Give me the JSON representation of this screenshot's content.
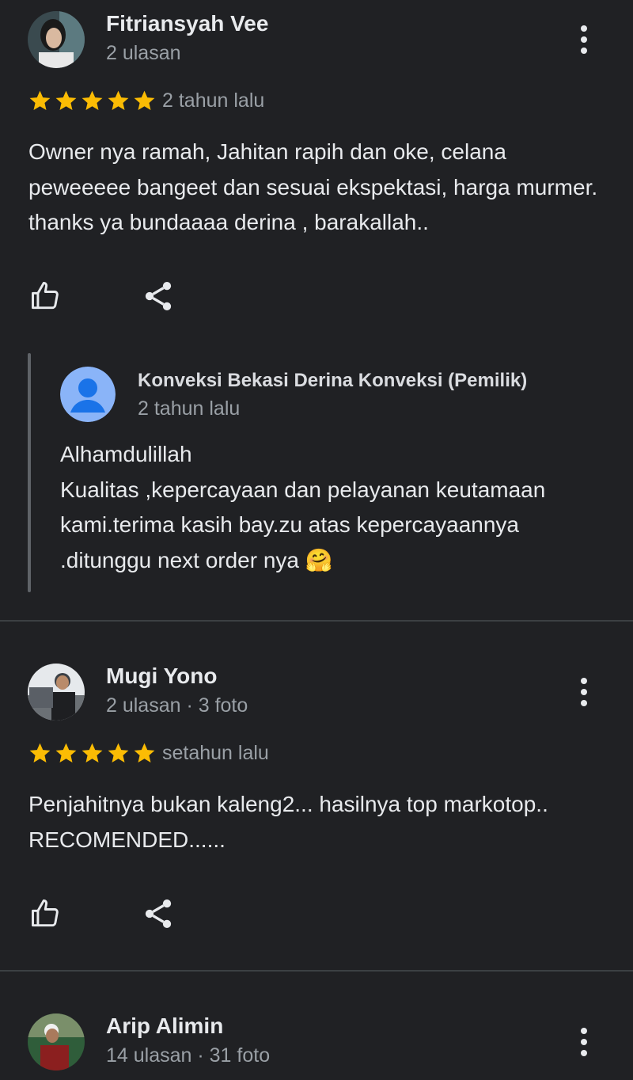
{
  "colors": {
    "background": "#202124",
    "star": "#fbbc04",
    "muted": "#9aa0a6",
    "owner_avatar": "#8ab4f8"
  },
  "reviews": [
    {
      "name": "Fitriansyah Vee",
      "meta": "2 ulasan",
      "rating": 5,
      "time": "2 tahun lalu",
      "text": "Owner nya ramah, Jahitan rapih dan oke, celana peweeeee bangeet dan sesuai ekspektasi, harga murmer. thanks ya bundaaaa derina , barakallah..",
      "reply": {
        "owner": "Konveksi Bekasi Derina Konveksi (Pemilik)",
        "time": "2 tahun lalu",
        "text": "Alhamdulillah\nKualitas ,kepercayaan dan pelayanan keutamaan kami.terima kasih bay.zu atas kepercayaannya .ditunggu next order nya 🤗"
      }
    },
    {
      "name": "Mugi Yono",
      "meta": "2 ulasan · 3 foto",
      "rating": 5,
      "time": "setahun lalu",
      "text": "Penjahitnya bukan kaleng2... hasilnya top markotop.. RECOMENDED......"
    },
    {
      "name": "Arip Alimin",
      "meta": "14 ulasan · 31 foto"
    }
  ]
}
